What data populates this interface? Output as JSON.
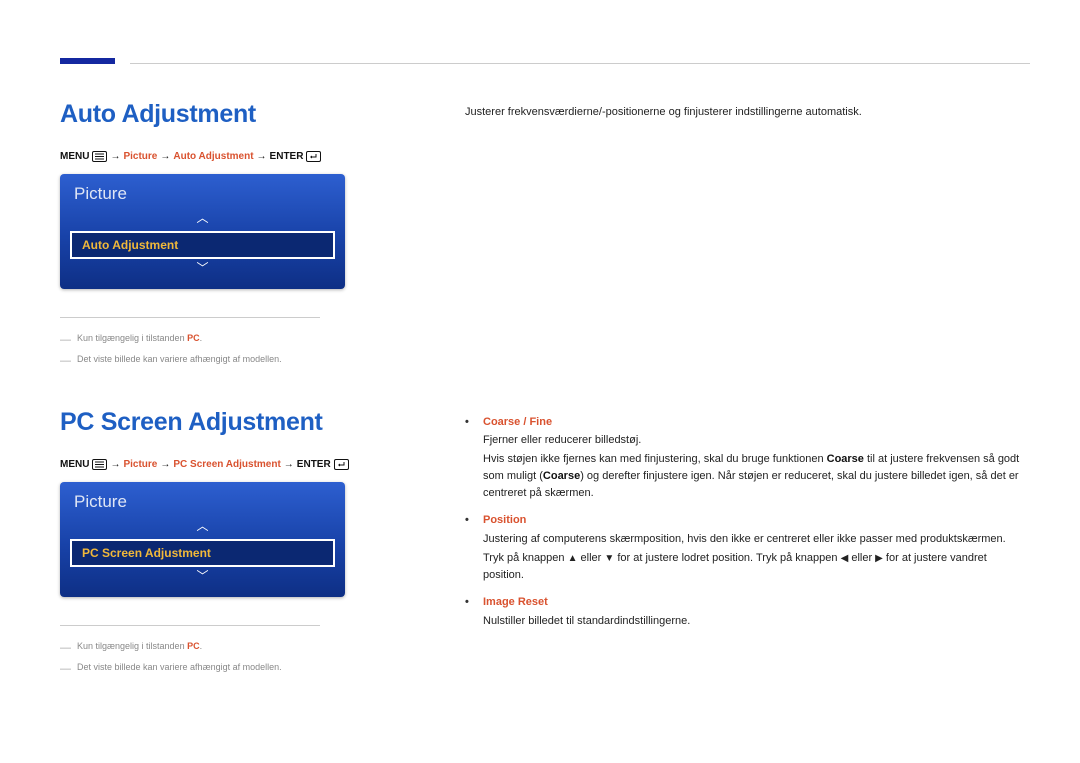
{
  "section1": {
    "heading": "Auto Adjustment",
    "path": {
      "menu": "MENU",
      "p1": "Picture",
      "p2": "Auto Adjustment",
      "enter": "ENTER"
    },
    "osd": {
      "title": "Picture",
      "selected": "Auto Adjustment"
    },
    "footnotes": {
      "f1_prefix": "Kun tilgængelig i tilstanden ",
      "f1_accent": "PC",
      "f1_suffix": ".",
      "f2": "Det viste billede kan variere afhængigt af modellen."
    },
    "right_intro": "Justerer frekvensværdierne/-positionerne og finjusterer indstillingerne automatisk."
  },
  "section2": {
    "heading": "PC Screen Adjustment",
    "path": {
      "menu": "MENU",
      "p1": "Picture",
      "p2": "PC Screen Adjustment",
      "enter": "ENTER"
    },
    "osd": {
      "title": "Picture",
      "selected": "PC Screen Adjustment"
    },
    "footnotes": {
      "f1_prefix": "Kun tilgængelig i tilstanden ",
      "f1_accent": "PC",
      "f1_suffix": ".",
      "f2": "Det viste billede kan variere afhængigt af modellen."
    },
    "bullets": {
      "b1": {
        "label": "Coarse / Fine",
        "line1": "Fjerner eller reducerer billedstøj.",
        "line2_a": "Hvis støjen ikke fjernes kan med finjustering, skal du bruge funktionen ",
        "line2_b": "Coarse",
        "line2_c": " til at justere frekvensen så godt som muligt (",
        "line2_d": "Coarse",
        "line2_e": ") og derefter finjustere igen. Når støjen er reduceret, skal du justere billedet igen, så det er centreret på skærmen."
      },
      "b2": {
        "label": "Position",
        "line1": "Justering af computerens skærmposition, hvis den ikke er centreret eller ikke passer med produktskærmen.",
        "line2_a": "Tryk på knappen ",
        "line2_b": " eller ",
        "line2_c": " for at justere lodret position. Tryk på knappen ",
        "line2_d": " eller ",
        "line2_e": " for at justere vandret position."
      },
      "b3": {
        "label": "Image Reset",
        "line1": "Nulstiller billedet til standardindstillingerne."
      }
    }
  },
  "arrow": "→"
}
